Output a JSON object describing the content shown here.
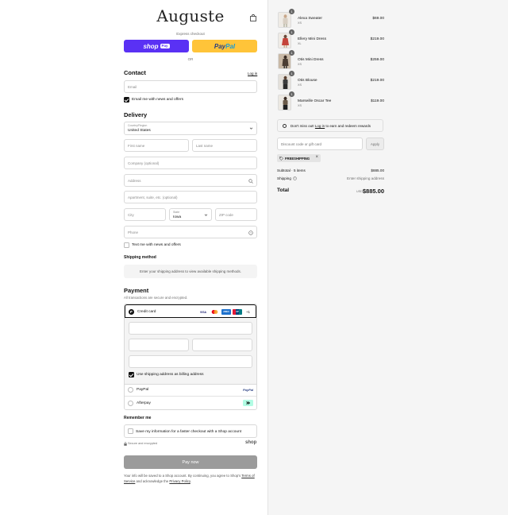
{
  "brand": {
    "name": "Auguste"
  },
  "express": {
    "label": "Express checkout",
    "shop_pay_label": "shop",
    "shop_pay_badge": "Pay",
    "paypal_label_1": "Pay",
    "paypal_label_2": "Pal",
    "or_label": "OR"
  },
  "contact": {
    "heading": "Contact",
    "login_link": "Log in",
    "email_placeholder": "Email",
    "news_label": "Email me with news and offers"
  },
  "delivery": {
    "heading": "Delivery",
    "country_label": "Country/Region",
    "country_value": "United States",
    "first_name_placeholder": "First name",
    "last_name_placeholder": "Last name",
    "company_placeholder": "Company (optional)",
    "address_placeholder": "Address",
    "apartment_placeholder": "Apartment, suite, etc. (optional)",
    "city_placeholder": "City",
    "state_label": "State",
    "state_value": "Iowa",
    "zip_placeholder": "ZIP code",
    "phone_placeholder": "Phone",
    "text_label": "Text me with news and offers"
  },
  "shipping_method": {
    "heading": "Shipping method",
    "message": "Enter your shipping address to view available shipping methods."
  },
  "payment": {
    "heading": "Payment",
    "subtitle": "All transactions are secure and encrypted.",
    "credit_card_label": "Credit card",
    "more_cards": "+1",
    "card_logos": [
      "VISA",
      "mc",
      "AMEX",
      "UP"
    ],
    "billing_label": "Use shipping address as billing address",
    "paypal_label": "PayPal",
    "paypal_logo": "PayPal",
    "afterpay_label": "Afterpay"
  },
  "remember": {
    "heading": "Remember me",
    "label": "Save my information for a faster checkout with a Shop account",
    "secure_label": "Secure and encrypted",
    "shop_logo": "shop"
  },
  "pay_now": {
    "label": "Pay now"
  },
  "legal": {
    "text_1": "Your info will be saved to a Shop account. By continuing, you agree to Shop's",
    "terms": "Terms of Service",
    "text_2": "and acknowledge the",
    "privacy": "Privacy Policy",
    "text_3": "."
  },
  "cart": {
    "items": [
      {
        "name": "Alexa Sweater",
        "variant": "XS",
        "price": "$69.00",
        "qty": "1",
        "color": "#d8cfc3"
      },
      {
        "name": "Ellery Mini Dress",
        "variant": "XL",
        "price": "$219.00",
        "qty": "1",
        "color": "#c4443a"
      },
      {
        "name": "Otis Mini Dress",
        "variant": "XS",
        "price": "$259.00",
        "qty": "1",
        "color": "#4a3d33"
      },
      {
        "name": "Otis Blouse",
        "variant": "XS",
        "price": "$219.00",
        "qty": "1",
        "color": "#3b3b3b"
      },
      {
        "name": "Marseille Oscar Tee",
        "variant": "XS",
        "price": "$119.00",
        "qty": "1",
        "color": "#6b5a48"
      }
    ],
    "points_text_1": "Don't miss out!",
    "points_link": "Log in",
    "points_text_2": "to earn and redeem rewards",
    "discount_placeholder": "Discount code or gift card",
    "apply_label": "Apply",
    "tag_label": "FREESHIPPING",
    "subtotal_label": "Subtotal · 5 items",
    "subtotal_value": "$885.00",
    "shipping_label": "Shipping",
    "shipping_value": "Enter shipping address",
    "total_label": "Total",
    "total_currency": "USD",
    "total_value": "$885.00"
  }
}
